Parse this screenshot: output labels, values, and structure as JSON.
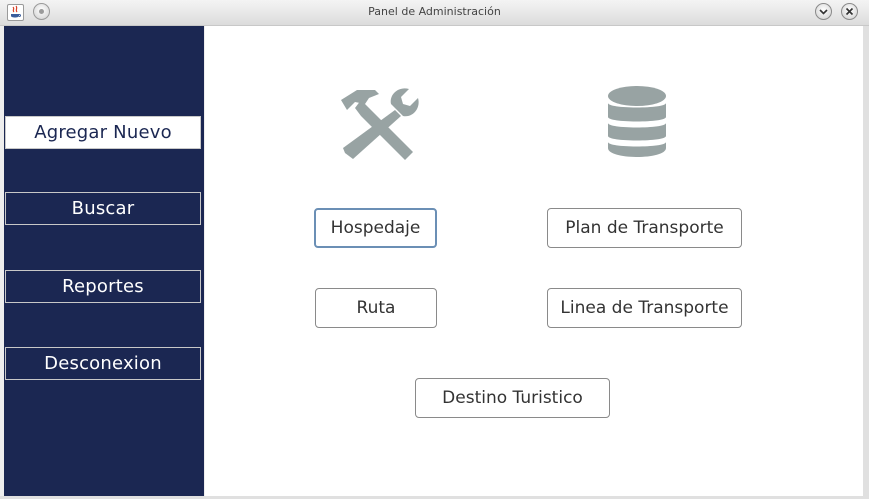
{
  "window": {
    "title": "Panel de Administración"
  },
  "sidebar": {
    "items": [
      {
        "label": "Agregar Nuevo",
        "active": true
      },
      {
        "label": "Buscar",
        "active": false
      },
      {
        "label": "Reportes",
        "active": false
      },
      {
        "label": "Desconexion",
        "active": false
      }
    ]
  },
  "main": {
    "icons": [
      "tools-icon",
      "database-icon"
    ],
    "buttons": {
      "hospedaje": "Hospedaje",
      "plan_transporte": "Plan de Transporte",
      "ruta": "Ruta",
      "linea_transporte": "Linea de Transporte",
      "destino_turistico": "Destino Turistico"
    }
  },
  "colors": {
    "sidebar_bg": "#1b2752",
    "icon_gray": "#98a3a3"
  }
}
